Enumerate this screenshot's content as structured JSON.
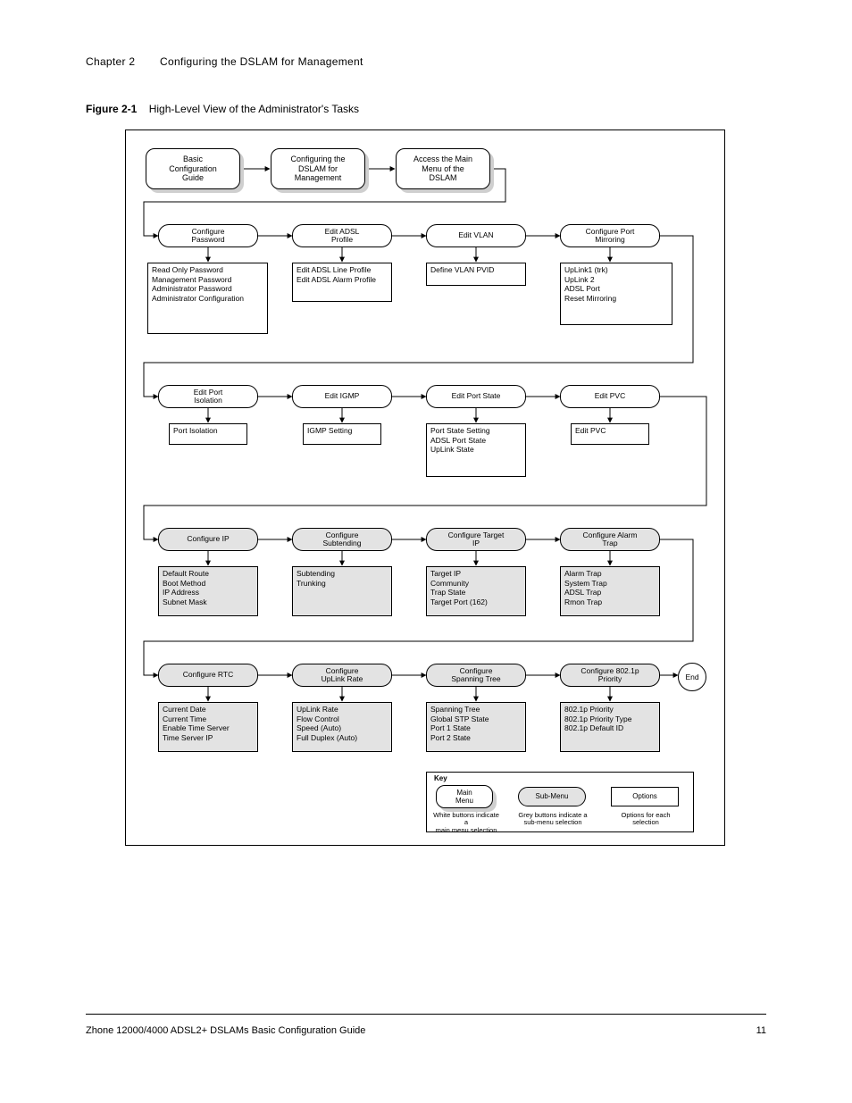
{
  "header": {
    "chapter": "Chapter 2",
    "title": "Configuring the DSLAM for Management"
  },
  "figure": {
    "number": "Figure 2-1",
    "caption": "High-Level View of the Administrator's Tasks"
  },
  "row1": {
    "a": "Basic\nConfiguration\nGuide",
    "b": "Configuring the\nDSLAM for\nManagement",
    "c": "Access the Main\nMenu of the\nDSLAM"
  },
  "row2": {
    "p1": {
      "menu": "Configure\nPassword",
      "opts": "Read Only Password\nManagement Password\nAdministrator Password\nAdministrator Configuration"
    },
    "p2": {
      "menu": "Edit ADSL\nProfile",
      "opts": "Edit ADSL Line Profile\nEdit ADSL Alarm Profile"
    },
    "p3": {
      "menu": "Edit VLAN",
      "opts": "Define VLAN PVID"
    },
    "p4": {
      "menu": "Configure Port\nMirroring",
      "opts": "UpLink1 (trk)\nUpLink 2\nADSL Port\nReset Mirroring"
    }
  },
  "row3": {
    "p1": {
      "menu": "Edit Port\nIsolation",
      "opts": "Port Isolation"
    },
    "p2": {
      "menu": "Edit IGMP",
      "opts": "IGMP Setting"
    },
    "p3": {
      "menu": "Edit Port State",
      "opts": "Port State Setting\nADSL Port State\nUpLink State"
    },
    "p4": {
      "menu": "Edit PVC",
      "opts": "Edit PVC"
    }
  },
  "row4": {
    "p1": {
      "menu": "Configure IP",
      "opts": "Default Route\nBoot Method\nIP Address\nSubnet Mask"
    },
    "p2": {
      "menu": "Configure\nSubtending",
      "opts": "Subtending\nTrunking"
    },
    "p3": {
      "menu": "Configure Target\nIP",
      "opts": "Target IP\nCommunity\nTrap State\nTarget Port (162)"
    },
    "p4": {
      "menu": "Configure Alarm\nTrap",
      "opts": "Alarm Trap\nSystem Trap\nADSL Trap\nRmon Trap"
    }
  },
  "row5": {
    "p1": {
      "menu": "Configure RTC",
      "opts": "Current Date\nCurrent Time\nEnable Time Server\nTime Server IP"
    },
    "p2": {
      "menu": "Configure\nUpLink Rate",
      "opts": "UpLink Rate\nFlow Control\nSpeed (Auto)\nFull Duplex (Auto)"
    },
    "p3": {
      "menu": "Configure\nSpanning Tree",
      "opts": "Spanning Tree\nGlobal STP State\nPort 1 State\nPort 2 State"
    },
    "p4": {
      "menu": "Configure 802.1p\nPriority",
      "opts": "802.1p Priority\n802.1p Priority Type\n802.1p Default ID"
    },
    "end": "End"
  },
  "key": {
    "title": "Key",
    "white_button": "Main\nMenu",
    "grey_pill": "Sub-Menu",
    "options": "Options",
    "white_button_caption": "White buttons indicate a\nmain menu selection",
    "grey_pill_caption": "Grey buttons indicate a\nsub-menu selection",
    "options_caption": "Options for each\nselection"
  },
  "footer": {
    "left": "Zhone 12000/4000 ADSL2+ DSLAMs Basic Configuration Guide",
    "right": "11"
  }
}
